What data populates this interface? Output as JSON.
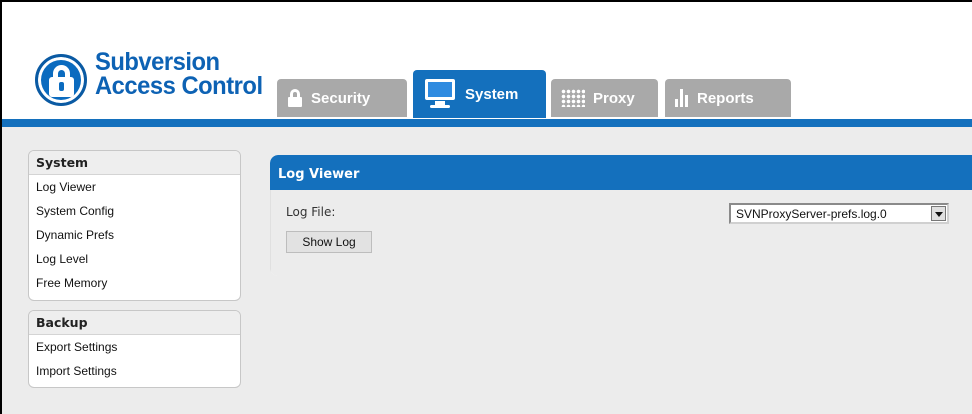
{
  "app": {
    "name_line1": "Subversion",
    "name_line2": "Access Control",
    "brand_color": "#1470bd"
  },
  "tabs": [
    {
      "label": "Security",
      "icon": "lock-icon",
      "active": false
    },
    {
      "label": "System",
      "icon": "monitor-icon",
      "active": true
    },
    {
      "label": "Proxy",
      "icon": "network-dots-icon",
      "active": false
    },
    {
      "label": "Reports",
      "icon": "bar-chart-icon",
      "active": false
    }
  ],
  "sidebar": {
    "system": {
      "header": "System",
      "items": [
        "Log Viewer",
        "System Config",
        "Dynamic Prefs",
        "Log Level",
        "Free Memory"
      ]
    },
    "backup": {
      "header": "Backup",
      "items": [
        "Export Settings",
        "Import Settings"
      ]
    }
  },
  "main": {
    "title": "Log Viewer",
    "log_file_label": "Log File:",
    "log_file_value": "SVNProxyServer-prefs.log.0",
    "show_log_label": "Show Log"
  }
}
